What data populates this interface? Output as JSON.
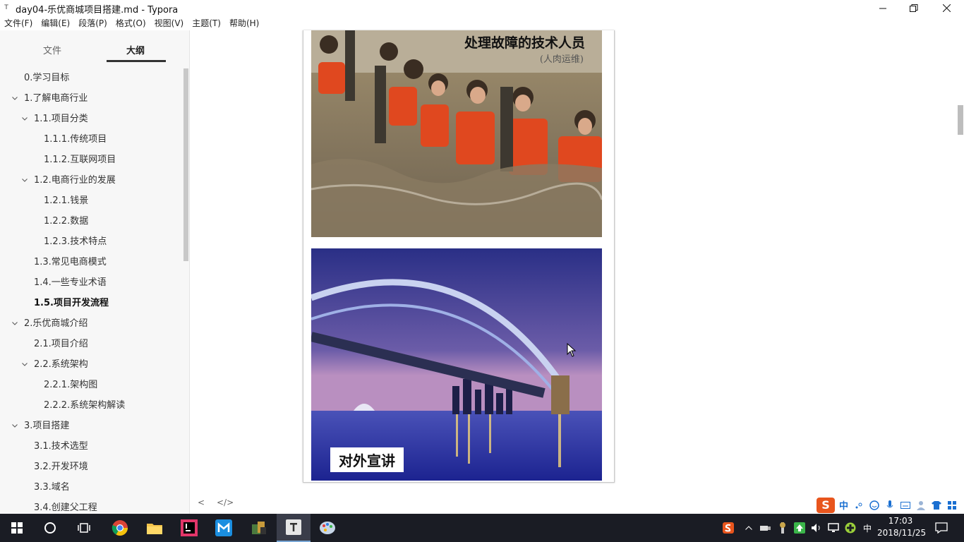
{
  "window": {
    "title": "day04-乐优商城项目搭建.md - Typora",
    "app_icon": "T"
  },
  "menu": [
    "文件(F)",
    "编辑(E)",
    "段落(P)",
    "格式(O)",
    "视图(V)",
    "主题(T)",
    "帮助(H)"
  ],
  "sidebar": {
    "tabs": {
      "files": "文件",
      "outline": "大纲"
    },
    "outline": [
      {
        "label": "0.学习目标"
      },
      {
        "label": "1.了解电商行业"
      },
      {
        "label": "1.1.项目分类"
      },
      {
        "label": "1.1.1.传统项目"
      },
      {
        "label": "1.1.2.互联网项目"
      },
      {
        "label": "1.2.电商行业的发展"
      },
      {
        "label": "1.2.1.钱景"
      },
      {
        "label": "1.2.2.数据"
      },
      {
        "label": "1.2.3.技术特点"
      },
      {
        "label": "1.3.常见电商模式"
      },
      {
        "label": "1.4.一些专业术语"
      },
      {
        "label": "1.5.项目开发流程"
      },
      {
        "label": "2.乐优商城介绍"
      },
      {
        "label": "2.1.项目介绍"
      },
      {
        "label": "2.2.系统架构"
      },
      {
        "label": "2.2.1.架构图"
      },
      {
        "label": "2.2.2.系统架构解读"
      },
      {
        "label": "3.项目搭建"
      },
      {
        "label": "3.1.技术选型"
      },
      {
        "label": "3.2.开发环境"
      },
      {
        "label": "3.3.域名"
      },
      {
        "label": "3.4.创建父工程"
      }
    ]
  },
  "editor": {
    "image1_caption": "处理故障的技术人员",
    "image1_subcaption": "(人肉运维)",
    "image2_caption": "对外宣讲",
    "footer_left": "<",
    "footer_source": "</>"
  },
  "ime": {
    "logo": "S",
    "mode": "中"
  },
  "tray": {
    "ime_indicator": "中",
    "time": "17:03",
    "date": "2018/11/25"
  },
  "colors": {
    "accent": "#333333",
    "taskbar": "#1a1c24",
    "sidebar": "#f7f7f7"
  }
}
